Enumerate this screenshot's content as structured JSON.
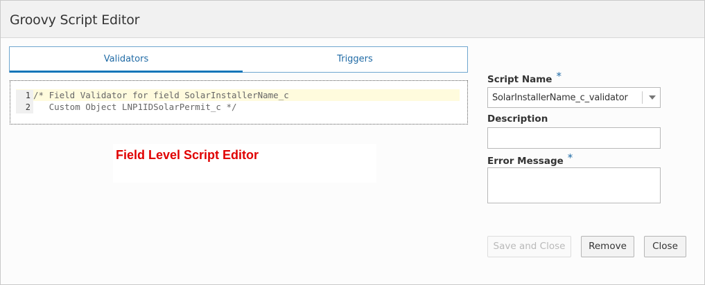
{
  "dialog": {
    "title": "Groovy Script Editor"
  },
  "tabs": [
    {
      "label": "Validators",
      "active": true
    },
    {
      "label": "Triggers",
      "active": false
    }
  ],
  "editor": {
    "lines": [
      {
        "number": "1",
        "text": "/* Field Validator for field SolarInstallerName_c"
      },
      {
        "number": "2",
        "text": "   Custom Object LNP1IDSolarPermit_c */"
      }
    ]
  },
  "callout": {
    "text": "Field Level Script Editor",
    "color": "#e00000"
  },
  "form": {
    "script_name_label": "Script Name",
    "script_name_value": "SolarInstallerName_c_validator",
    "description_label": "Description",
    "description_value": "",
    "error_message_label": "Error Message",
    "error_message_value": "",
    "required_mark": "*"
  },
  "buttons": {
    "save_close": "Save and Close",
    "remove": "Remove",
    "close": "Close"
  },
  "colors": {
    "accent": "#0b74b8",
    "tab_text": "#1f6aa5",
    "highlight_line": "#fffbdd"
  }
}
